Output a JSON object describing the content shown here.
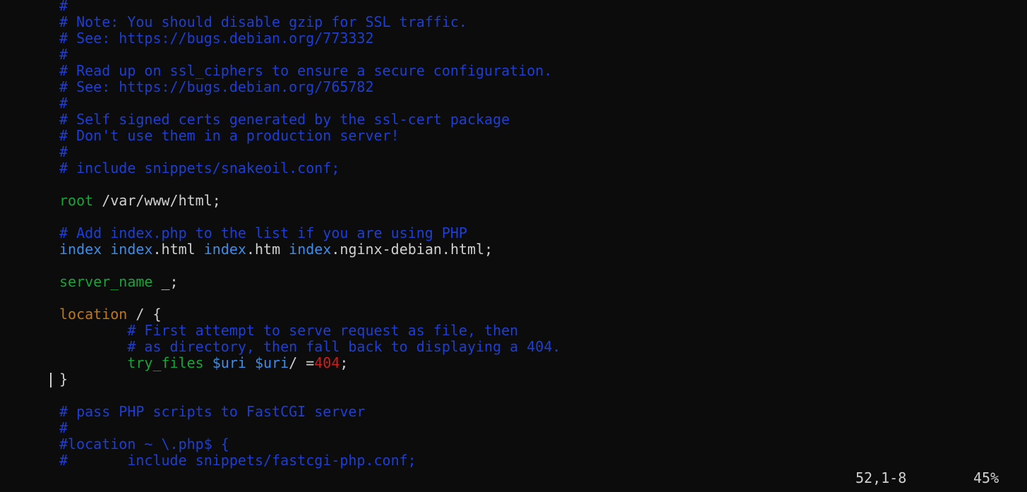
{
  "editor": {
    "lines": [
      [
        {
          "t": "#",
          "k": "comment"
        }
      ],
      [
        {
          "t": "# Note: You should disable gzip for SSL traffic.",
          "k": "comment"
        }
      ],
      [
        {
          "t": "# See: https://bugs.debian.org/773332",
          "k": "comment"
        }
      ],
      [
        {
          "t": "#",
          "k": "comment"
        }
      ],
      [
        {
          "t": "# Read up on ssl_ciphers to ensure a secure configuration.",
          "k": "comment"
        }
      ],
      [
        {
          "t": "# See: https://bugs.debian.org/765782",
          "k": "comment"
        }
      ],
      [
        {
          "t": "#",
          "k": "comment"
        }
      ],
      [
        {
          "t": "# Self signed certs generated by the ssl-cert package",
          "k": "comment"
        }
      ],
      [
        {
          "t": "# Don't use them in a production server!",
          "k": "comment"
        }
      ],
      [
        {
          "t": "#",
          "k": "comment"
        }
      ],
      [
        {
          "t": "# include snippets/snakeoil.conf;",
          "k": "comment"
        }
      ],
      [],
      [
        {
          "t": "root",
          "k": "green"
        },
        {
          "t": " /var/www/html;",
          "k": "plain"
        }
      ],
      [],
      [
        {
          "t": "# Add index.php to the list if you are using PHP",
          "k": "comment"
        }
      ],
      [
        {
          "t": "index",
          "k": "blue"
        },
        {
          "t": " ",
          "k": "plain"
        },
        {
          "t": "index",
          "k": "blue"
        },
        {
          "t": ".html ",
          "k": "plain"
        },
        {
          "t": "index",
          "k": "blue"
        },
        {
          "t": ".htm ",
          "k": "plain"
        },
        {
          "t": "index",
          "k": "blue"
        },
        {
          "t": ".nginx-debian.html;",
          "k": "plain"
        }
      ],
      [],
      [
        {
          "t": "server_name",
          "k": "green"
        },
        {
          "t": " _;",
          "k": "plain"
        }
      ],
      [],
      [
        {
          "t": "location",
          "k": "brown"
        },
        {
          "t": " / {",
          "k": "plain"
        }
      ],
      [
        {
          "t": "        # First attempt to serve request as file, then",
          "k": "comment"
        }
      ],
      [
        {
          "t": "        # as directory, then fall back to displaying a 404.",
          "k": "comment"
        }
      ],
      [
        {
          "t": "        ",
          "k": "plain"
        },
        {
          "t": "try_files",
          "k": "green"
        },
        {
          "t": " ",
          "k": "plain"
        },
        {
          "t": "$uri",
          "k": "blue"
        },
        {
          "t": " ",
          "k": "plain"
        },
        {
          "t": "$uri",
          "k": "blue"
        },
        {
          "t": "/ =",
          "k": "plain"
        },
        {
          "t": "404",
          "k": "red"
        },
        {
          "t": ";",
          "k": "plain"
        }
      ],
      [
        {
          "t": "}",
          "k": "plain"
        }
      ],
      [],
      [
        {
          "t": "# pass PHP scripts to FastCGI server",
          "k": "comment"
        }
      ],
      [
        {
          "t": "#",
          "k": "comment"
        }
      ],
      [
        {
          "t": "#location ~ \\.php$ {",
          "k": "comment"
        }
      ],
      [
        {
          "t": "#       include snippets/fastcgi-php.conf;",
          "k": "comment"
        }
      ]
    ]
  },
  "status": {
    "position": "52,1-8",
    "percent": "45%"
  },
  "colors": {
    "background": "#0c0c0c",
    "comment": "#1e3ed4",
    "keyword_green": "#17a53a",
    "keyword_brown": "#c07814",
    "keyword_blue": "#3b8eea",
    "number_red": "#d21c1c",
    "text": "#d0d0d0"
  }
}
